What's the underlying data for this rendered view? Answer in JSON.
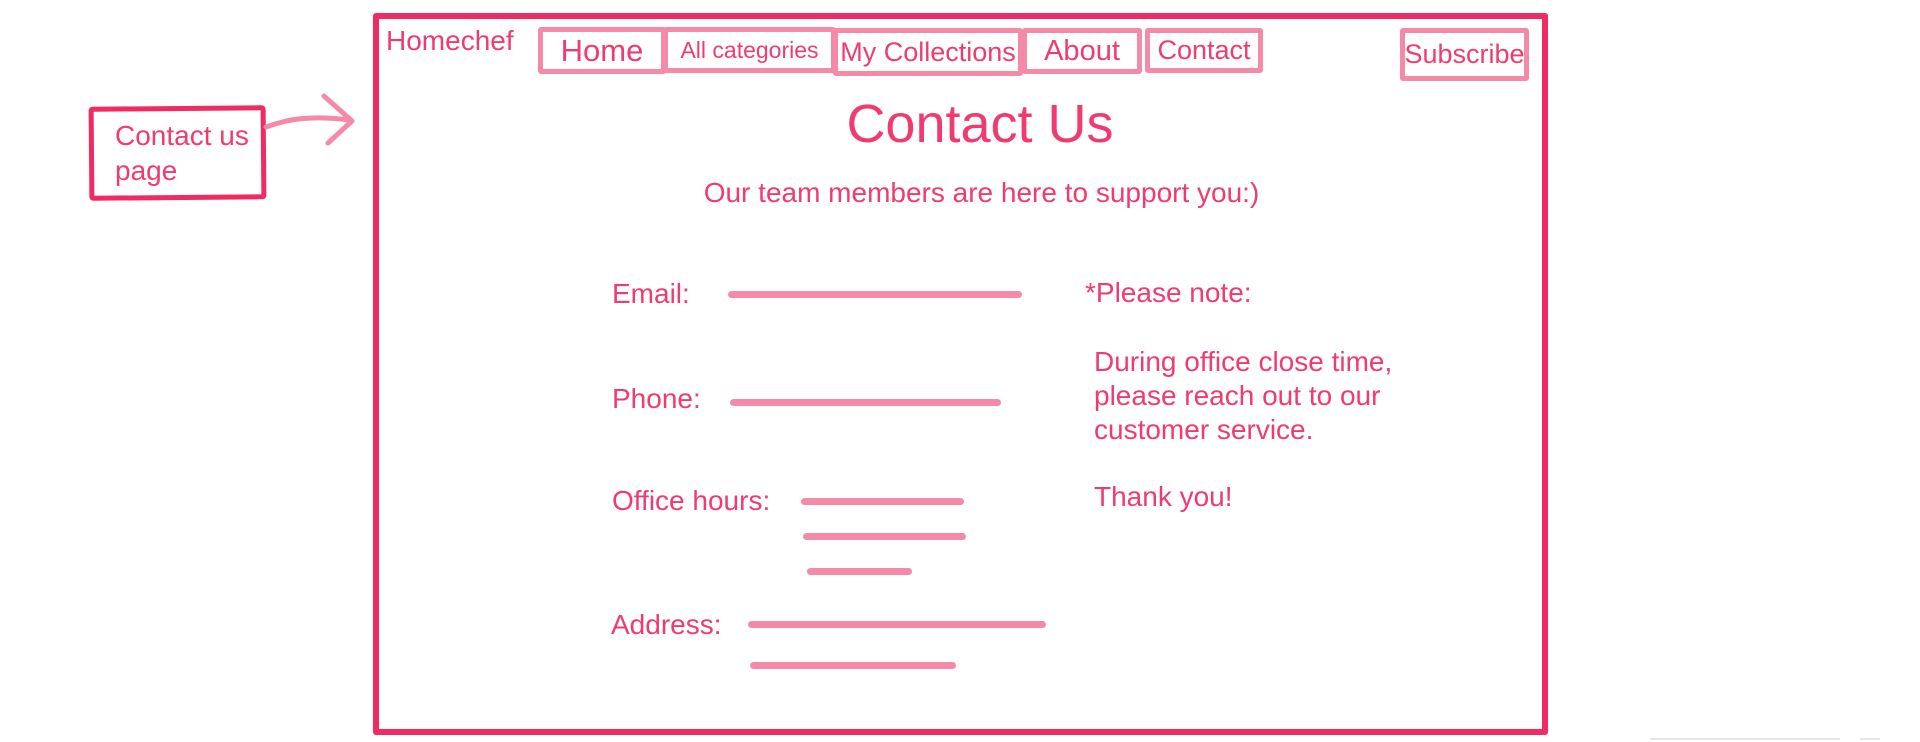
{
  "annotation": {
    "label_line1": "Contact us",
    "label_line2": "page"
  },
  "nav": {
    "brand": "Homechef",
    "items": [
      {
        "label": "Home"
      },
      {
        "label": "All categories"
      },
      {
        "label": "My Collections"
      },
      {
        "label": "About"
      },
      {
        "label": "Contact"
      }
    ],
    "subscribe": "Subscribe"
  },
  "page": {
    "title": "Contact Us",
    "subtitle": "Our team members are here to support you:)"
  },
  "form": {
    "email_label": "Email:",
    "phone_label": "Phone:",
    "office_hours_label": "Office hours:",
    "address_label": "Address:"
  },
  "note": {
    "heading": "*Please note:",
    "line1": "During office close time,",
    "line2": "please reach out to our",
    "line3": "customer service.",
    "thanks": "Thank you!"
  },
  "colors": {
    "primary": "#f02a62",
    "text": "#f03b70",
    "light": "#f58aa8"
  }
}
